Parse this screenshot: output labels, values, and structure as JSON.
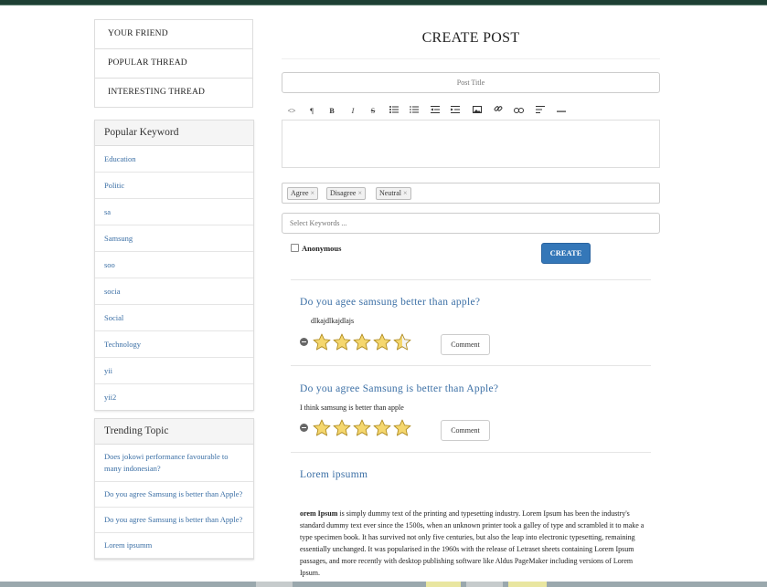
{
  "nav": {
    "items": [
      "YOUR FRIEND",
      "POPULAR THREAD",
      "INTERESTING THREAD"
    ]
  },
  "popular_keyword": {
    "heading": "Popular Keyword",
    "items": [
      "Education",
      "Politic",
      "sa",
      "Samsung",
      "soo",
      "socia",
      "Social",
      "Technology",
      "yii",
      "yii2"
    ]
  },
  "trending_topic": {
    "heading": "Trending Topic",
    "items": [
      "Does jokowi performance favourable to many indonesian?",
      "Do you agree Samsung is better than Apple?",
      "Do you agree Samsung is better than Apple?",
      "Lorem ipsumm"
    ]
  },
  "form": {
    "page_title": "CREATE POST",
    "post_title_placeholder": "Post Title",
    "toolbar": {
      "code": "<>",
      "paragraph": "¶",
      "bold": "B",
      "italic": "I",
      "strike": "S"
    },
    "tags": [
      "Agree",
      "Disagree",
      "Neutral"
    ],
    "tag_remove": "×",
    "keywords_placeholder": "Select Keywords ...",
    "anonymous_label": "Anonymous",
    "create_label": "CREATE"
  },
  "posts": [
    {
      "title": "Do you agee samsung better than apple?",
      "body": "dlkajdlkajdlajs",
      "rating": 4.5,
      "comment_label": "Comment"
    },
    {
      "title": "Do you agree Samsung is better than Apple?",
      "body": "I think samsung is better than apple",
      "rating": 5,
      "comment_label": "Comment"
    }
  ],
  "lorem": {
    "title": "Lorem ipsumm",
    "bold_lead": "orem Ipsum",
    "body": " is simply dummy text of the printing and typesetting industry. Lorem Ipsum has been the industry's standard dummy text ever since the 1500s, when an unknown printer took a galley of type and scrambled it to make a type specimen book. It has survived not only five centuries, but also the leap into electronic typesetting, remaining essentially unchanged. It was popularised in the 1960s with the release of Letraset sheets containing Lorem Ipsum passages, and more recently with desktop publishing software like Aldus PageMaker including versions of Lorem Ipsum."
  },
  "colors": {
    "link": "#3b6fa5",
    "primary_button": "#3477b8",
    "star_fill": "#f5d76e",
    "star_stroke": "#b08d24",
    "top_bar": "#1e4034"
  }
}
